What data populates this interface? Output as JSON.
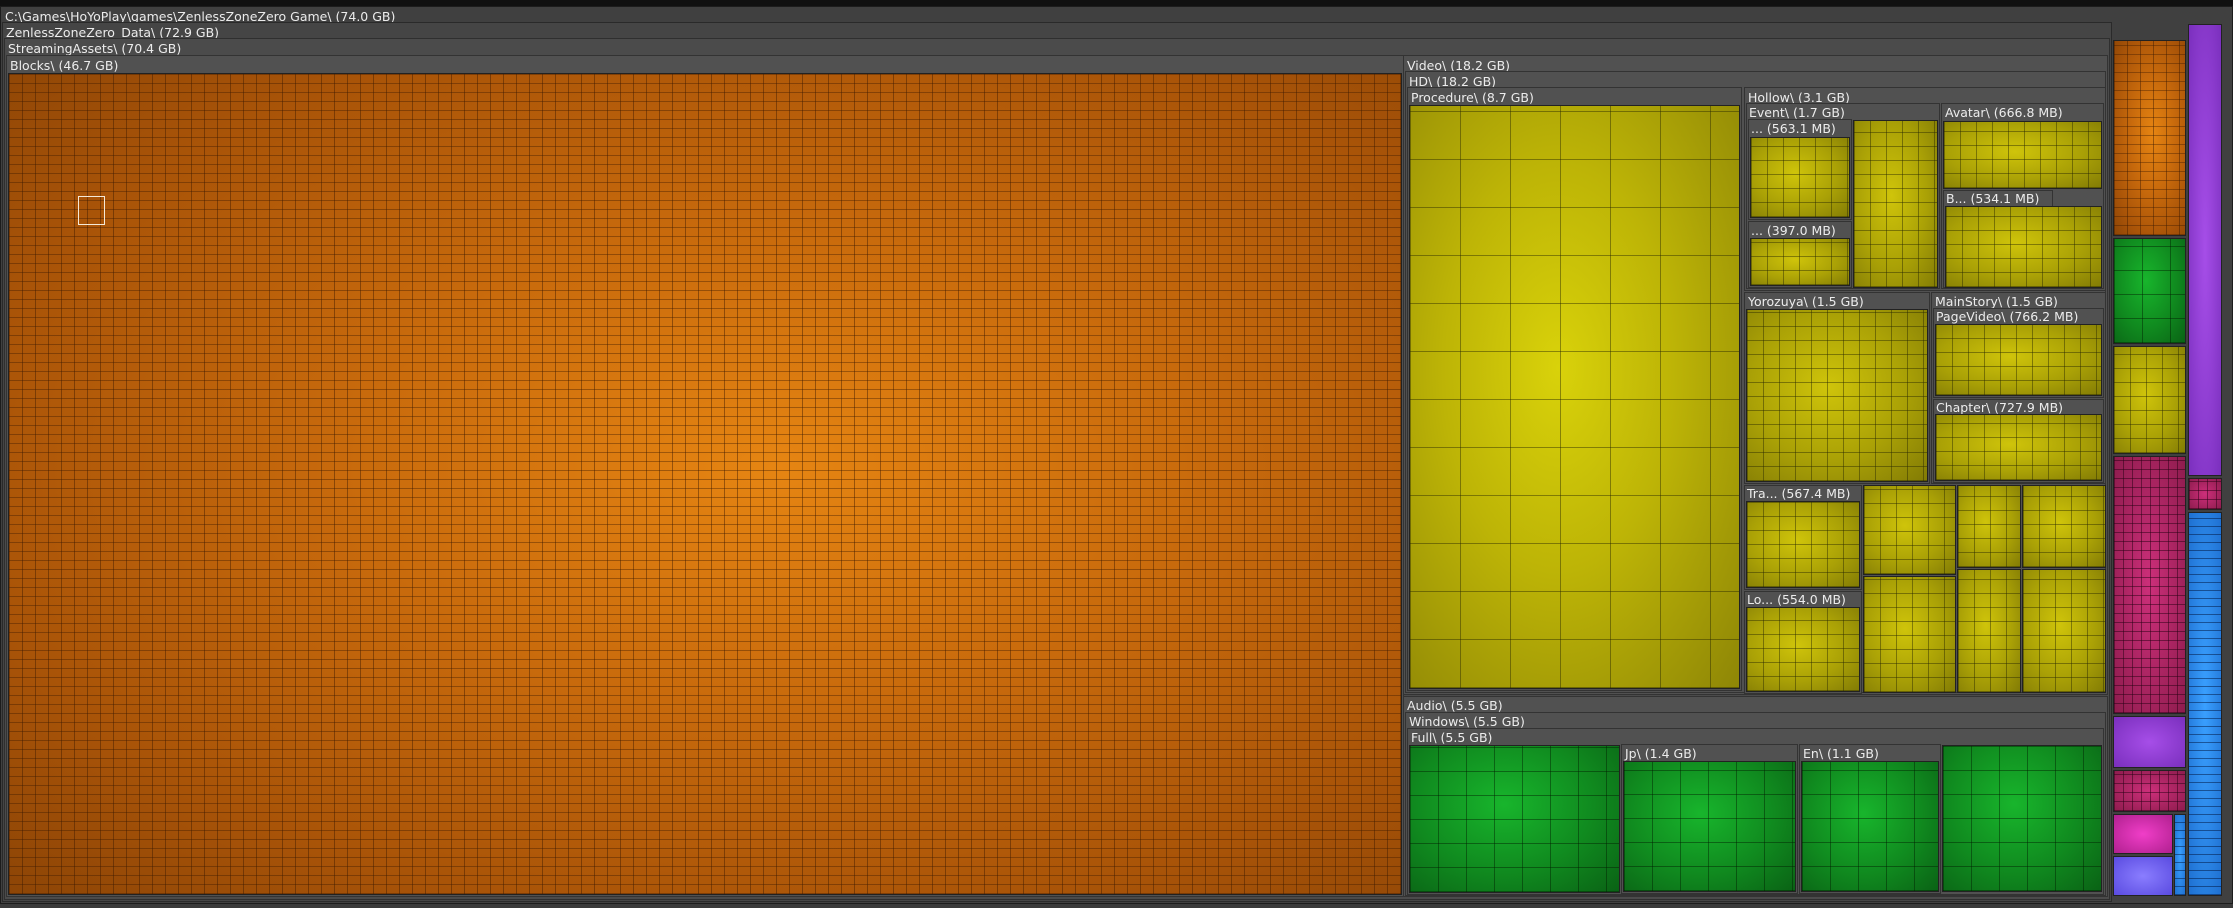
{
  "colors": {
    "blocks": "#c86a0c",
    "video": "#bdb406",
    "audio": "#108a1f",
    "other_purple": "#8a3fd0",
    "other_magenta": "#b02466",
    "other_blue": "#2a86ea"
  },
  "root": {
    "label": "C:\\Games\\HoYoPlay\\games\\ZenlessZoneZero Game\\ (74.0 GB)"
  },
  "data": {
    "label": "ZenlessZoneZero_Data\\ (72.9 GB)"
  },
  "streaming": {
    "label": "StreamingAssets\\ (70.4 GB)"
  },
  "blocks": {
    "label": "Blocks\\ (46.7 GB)"
  },
  "video": {
    "label": "Video\\ (18.2 GB)",
    "hd": {
      "label": "HD\\ (18.2 GB)"
    },
    "procedure": {
      "label": "Procedure\\ (8.7 GB)"
    },
    "hollow": {
      "label": "Hollow\\ (3.1 GB)",
      "event": {
        "label": "Event\\ (1.7 GB)",
        "a": "... (563.1 MB)",
        "b": "... (397.0 MB)"
      },
      "avatar": {
        "label": "Avatar\\ (666.8 MB)",
        "b": "B... (534.1 MB)"
      }
    },
    "yorozuya": {
      "label": "Yorozuya\\ (1.5 GB)"
    },
    "mainstory": {
      "label": "MainStory\\ (1.5 GB)",
      "pagevideo": "PageVideo\\ (766.2 MB)",
      "chapter": "Chapter\\ (727.9 MB)"
    },
    "tra": {
      "label": "Tra... (567.4 MB)"
    },
    "lo": {
      "label": "Lo... (554.0 MB)"
    }
  },
  "audio": {
    "label": "Audio\\ (5.5 GB)",
    "windows": {
      "label": "Windows\\ (5.5 GB)"
    },
    "full": {
      "label": "Full\\ (5.5 GB)"
    },
    "jp": {
      "label": "Jp\\ (1.4 GB)"
    },
    "en": {
      "label": "En\\ (1.1 GB)"
    }
  }
}
